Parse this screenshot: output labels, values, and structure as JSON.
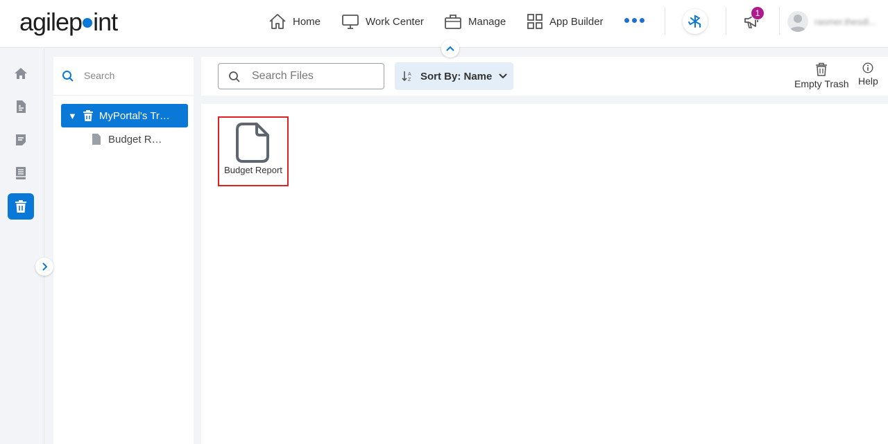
{
  "header": {
    "logo_text_1": "agilep",
    "logo_text_2": "int",
    "nav": {
      "home": "Home",
      "work_center": "Work Center",
      "manage": "Manage",
      "app_builder": "App Builder"
    },
    "notification_count": "1",
    "username": "rasmer.thesdl..."
  },
  "tree": {
    "search_placeholder": "Search",
    "root_label": "MyPortal's Trash",
    "child_label": "Budget Report"
  },
  "toolbar": {
    "search_placeholder": "Search Files",
    "sort_label": "Sort By: Name",
    "empty_trash_label": "Empty Trash",
    "help_label": "Help"
  },
  "files": [
    {
      "name": "Budget Report"
    }
  ],
  "colors": {
    "accent": "#0a78d6",
    "badge": "#b0198e",
    "highlight_border": "#e02020"
  }
}
